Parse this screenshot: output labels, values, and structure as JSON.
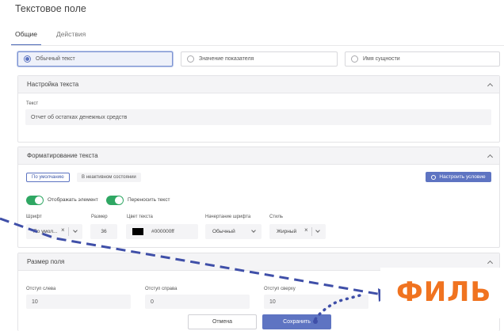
{
  "dialog": {
    "title": "Текстовое поле"
  },
  "tabs": [
    {
      "label": "Общие",
      "active": true
    },
    {
      "label": "Действия",
      "active": false
    }
  ],
  "source_options": [
    {
      "label": "Обычный текст",
      "selected": true
    },
    {
      "label": "Значение показателя",
      "selected": false
    },
    {
      "label": "Имя сущности",
      "selected": false
    }
  ],
  "text_settings": {
    "header": "Настройка текста",
    "text_label": "Текст",
    "text_value": "Отчет об остатках денежных средств"
  },
  "formatting": {
    "header": "Форматирование текста",
    "state_tabs": [
      {
        "label": "По умолчанию",
        "active": true
      },
      {
        "label": "В неактивном состоянии",
        "active": false
      }
    ],
    "configure_button": "Настроить условие",
    "toggles": [
      {
        "label": "Отображать элемент",
        "on": true
      },
      {
        "label": "Переносить текст",
        "on": true
      }
    ],
    "font": {
      "label": "Шрифт",
      "value": "По умол..."
    },
    "size": {
      "label": "Размер",
      "value": "36"
    },
    "color": {
      "label": "Цвет текста",
      "value": "#000000ff",
      "swatch": "#000000"
    },
    "weight": {
      "label": "Начертание шрифта",
      "value": "Обычный"
    },
    "style": {
      "label": "Стиль",
      "value": "Жирный"
    }
  },
  "field_size": {
    "header": "Размер поля",
    "left": {
      "label": "Отступ слева",
      "value": "10"
    },
    "right": {
      "label": "Отступ справа",
      "value": "0"
    },
    "top": {
      "label": "Отступ сверху",
      "value": "10"
    }
  },
  "footer": {
    "cancel": "Отмена",
    "save": "Сохранить"
  },
  "brand_overlay": {
    "text": "ФИЛЬ",
    "color": "#f07320",
    "arrow_color": "#3f4fa8"
  },
  "colors": {
    "accent": "#5e74c2",
    "toggle_on": "#2fa763"
  }
}
